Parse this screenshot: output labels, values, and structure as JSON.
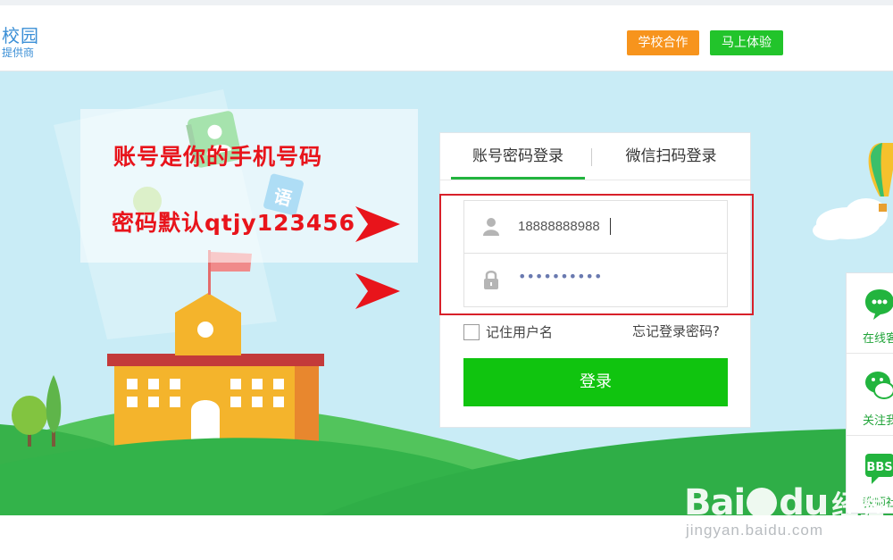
{
  "header": {
    "logo_main": "校园",
    "logo_sub": "提供商",
    "school_coop": "学校合作",
    "try_now": "马上体验"
  },
  "hints": {
    "account": "账号是你的手机号码",
    "password": "密码默认qtjy123456"
  },
  "banner": {
    "book_glyph": "语"
  },
  "login": {
    "tab_account": "账号密码登录",
    "tab_wechat": "微信扫码登录",
    "username_value": "18888888988",
    "password_mask": "••••••••••",
    "remember_label": "记住用户名",
    "forgot_label": "忘记登录密码?",
    "submit_label": "登录"
  },
  "side": {
    "online": "在线客",
    "follow": "关注我",
    "teacher": "教师社"
  },
  "watermark": {
    "brand_text": "Bai",
    "brand_du": "du",
    "brand_cn": "经验",
    "url": "jingyan.baidu.com"
  },
  "colors": {
    "accent_green": "#10c40f",
    "orange": "#f7941d",
    "hint_red": "#e8141b",
    "sky": "#c9ecf6"
  }
}
